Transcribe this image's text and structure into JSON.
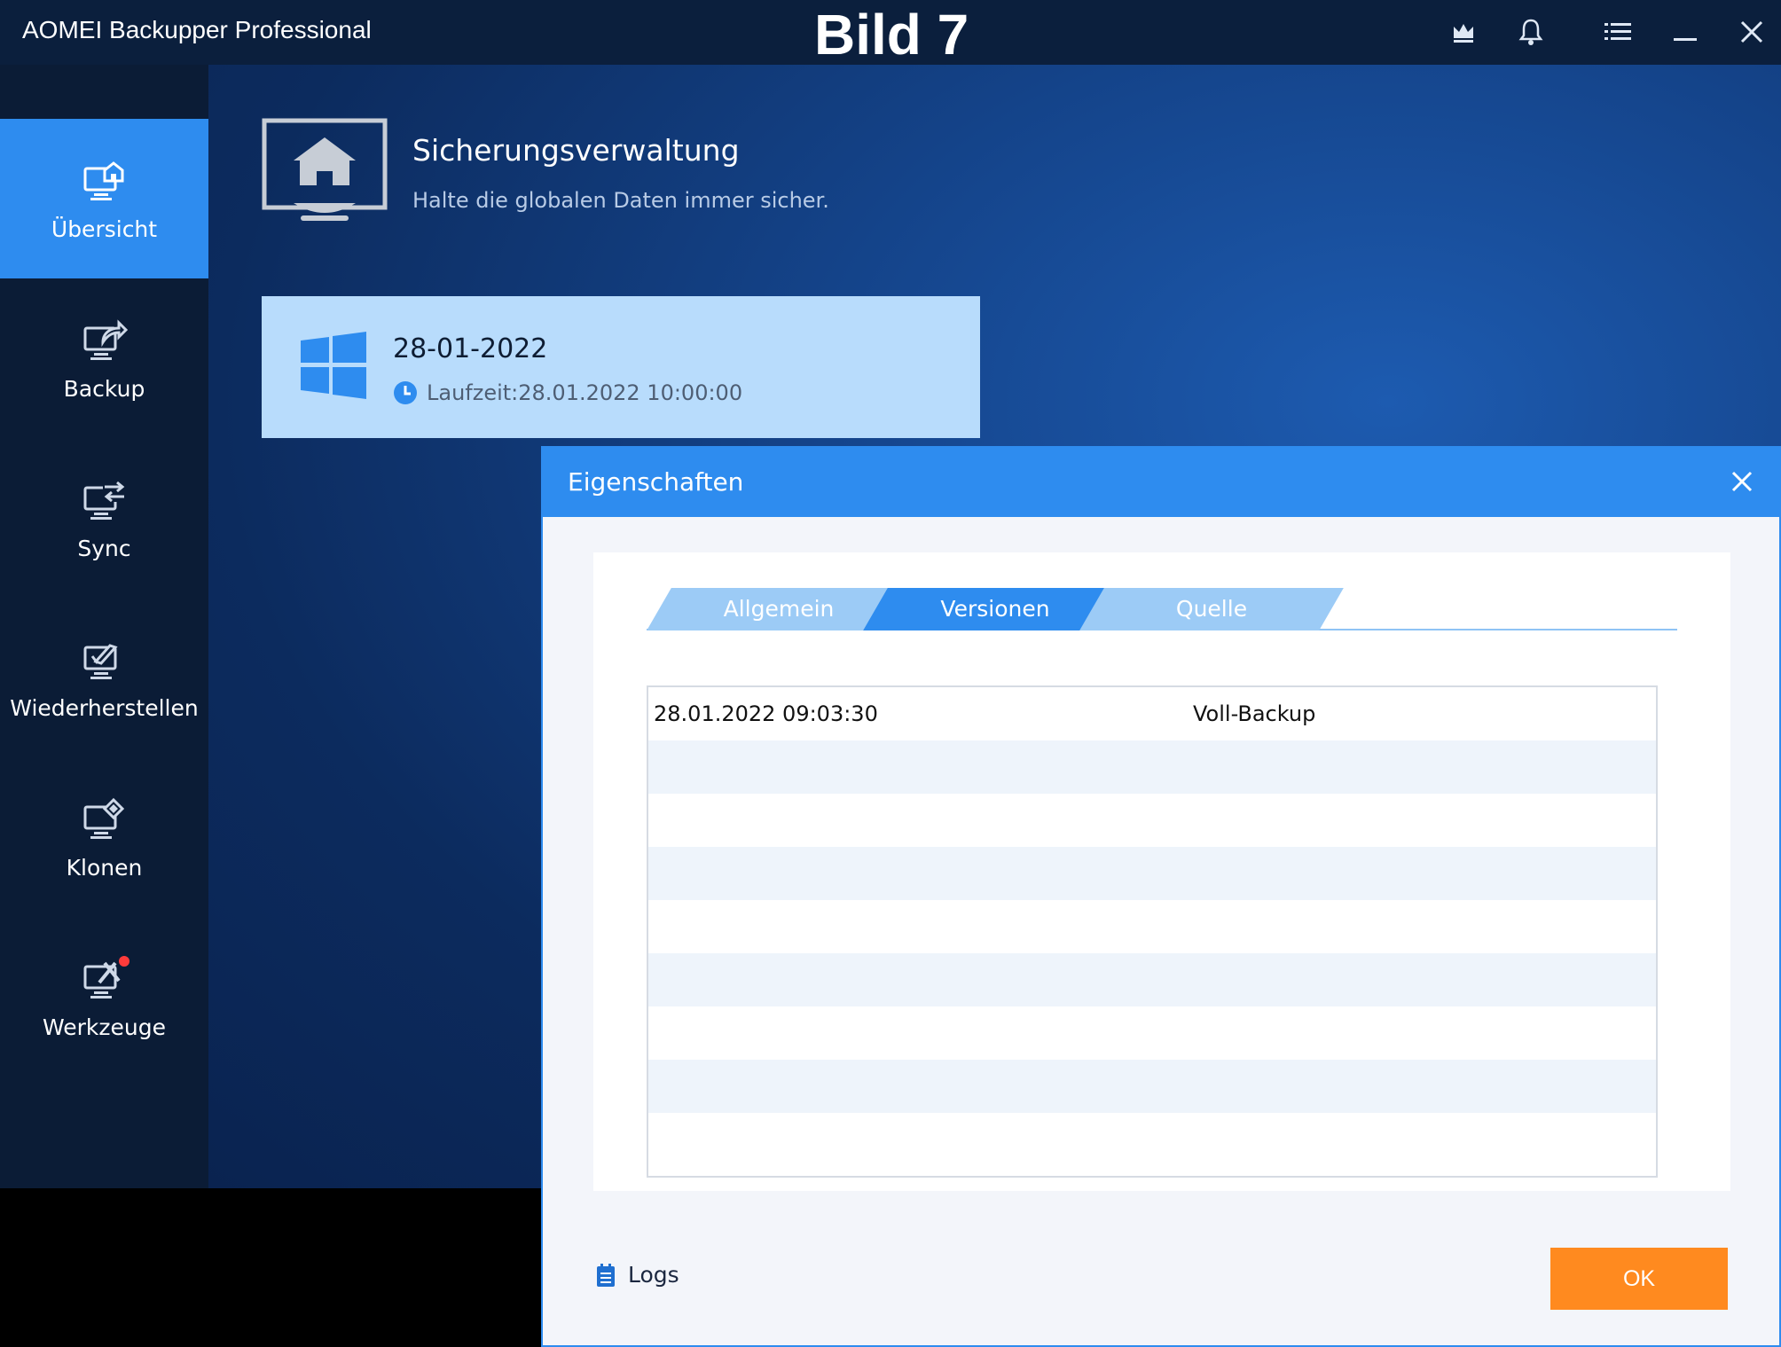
{
  "titlebar": {
    "app_title": "AOMEI Backupper Professional",
    "caption": "Bild 7",
    "icons": [
      "crown-icon",
      "bell-icon",
      "menu-icon",
      "minimize-icon",
      "close-icon"
    ]
  },
  "sidebar": {
    "items": [
      {
        "label": "Übersicht",
        "icon": "overview-icon",
        "active": true
      },
      {
        "label": "Backup",
        "icon": "backup-icon"
      },
      {
        "label": "Sync",
        "icon": "sync-icon"
      },
      {
        "label": "Wiederherstellen",
        "icon": "restore-icon"
      },
      {
        "label": "Klonen",
        "icon": "clone-icon"
      },
      {
        "label": "Werkzeuge",
        "icon": "tools-icon",
        "badge": true
      }
    ]
  },
  "main": {
    "title": "Sicherungsverwaltung",
    "subtitle": "Halte die globalen Daten immer sicher.",
    "backup_card": {
      "name": "28-01-2022",
      "runtime": "Laufzeit:28.01.2022 10:00:00"
    }
  },
  "dialog": {
    "title": "Eigenschaften",
    "tabs": [
      {
        "label": "Allgemein",
        "active": false
      },
      {
        "label": "Versionen",
        "active": true
      },
      {
        "label": "Quelle",
        "active": false
      }
    ],
    "versions": [
      {
        "date": "28.01.2022 09:03:30",
        "type": "Voll-Backup"
      }
    ],
    "logs_label": "Logs",
    "ok_label": "OK"
  },
  "colors": {
    "accent": "#2e8cef",
    "sidebar": "#0b1c36",
    "card": "#b8dcfc",
    "ok_button": "#ff8a1f",
    "badge": "#ff3b3b"
  }
}
